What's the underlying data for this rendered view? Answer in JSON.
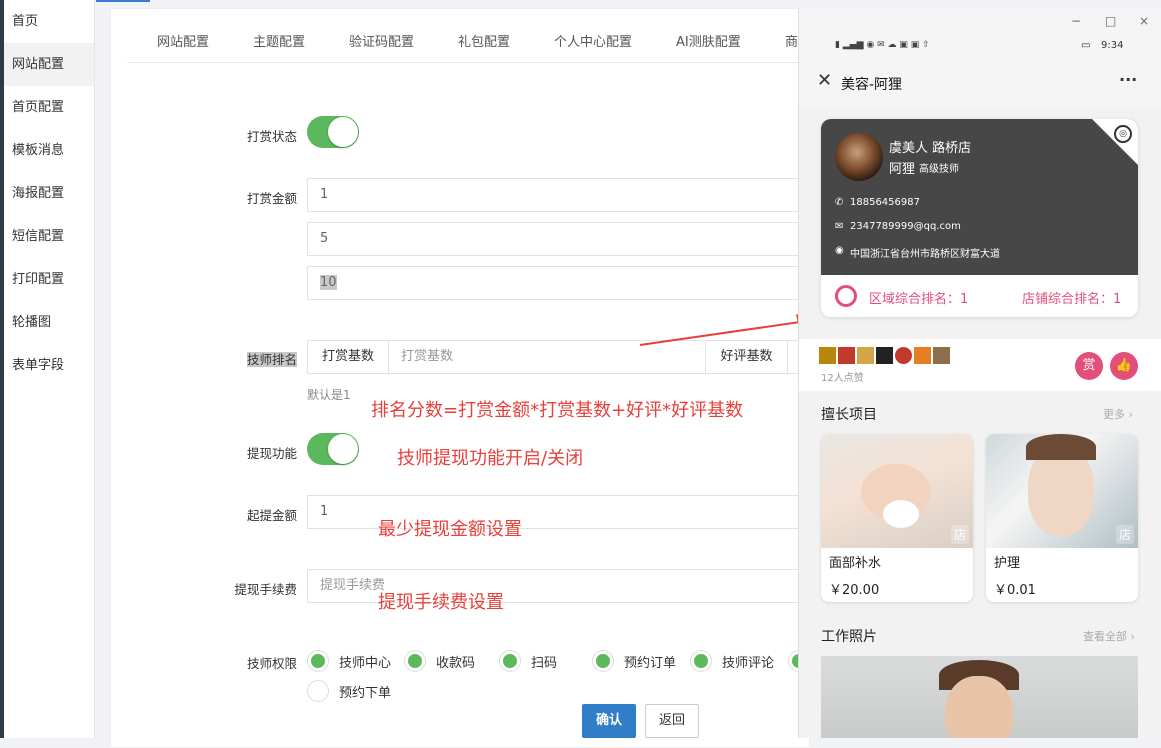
{
  "sidebar": {
    "items": [
      {
        "label": "首页"
      },
      {
        "label": "网站配置"
      },
      {
        "label": "首页配置"
      },
      {
        "label": "模板消息"
      },
      {
        "label": "海报配置"
      },
      {
        "label": "短信配置"
      },
      {
        "label": "打印配置"
      },
      {
        "label": "轮播图"
      },
      {
        "label": "表单字段"
      }
    ],
    "active_index": 1
  },
  "tabs": [
    "网站配置",
    "主题配置",
    "验证码配置",
    "礼包配置",
    "个人中心配置",
    "AI测肤配置",
    "商"
  ],
  "form": {
    "reward_status_label": "打赏状态",
    "reward_amount_label": "打赏金额",
    "reward_amounts": [
      "1",
      "5",
      "10"
    ],
    "ranking_label": "技师排名",
    "reward_base_addon": "打赏基数",
    "reward_base_placeholder": "打赏基数",
    "review_base_addon": "好评基数",
    "default_hint": "默认是1",
    "withdraw_label": "提现功能",
    "min_withdraw_label": "起提金额",
    "min_withdraw_value": "1",
    "fee_label": "提现手续费",
    "fee_placeholder": "提现手续费",
    "perm_label": "技师权限",
    "permissions": [
      {
        "label": "技师中心",
        "checked": true
      },
      {
        "label": "收款码",
        "checked": true
      },
      {
        "label": "扫码",
        "checked": true
      },
      {
        "label": "预约订单",
        "checked": true
      },
      {
        "label": "技师评论",
        "checked": true
      },
      {
        "label": "预约下单",
        "checked": false
      }
    ],
    "confirm_label": "确认",
    "back_label": "返回"
  },
  "annotations": {
    "formula": "排名分数=打赏金额*打赏基数+好评*好评基数",
    "withdraw": "技师提现功能开启/关闭",
    "min": "最少提现金额设置",
    "fee": "提现手续费设置"
  },
  "phone": {
    "window_controls": [
      "−",
      "□",
      "×"
    ],
    "time": "9:34",
    "title": "美容-阿狸",
    "more": "···",
    "store_name": "虞美人 路桥店",
    "tech_name": "阿狸",
    "tech_level": "高级技师",
    "phone": "18856456987",
    "email": "2347789999@qq.com",
    "address": "中国浙江省台州市路桥区财富大道",
    "region_rank": "区域综合排名：1",
    "store_rank": "店铺综合排名：1",
    "likes_count": "12人点赞",
    "reward_btn": "赏",
    "skills_title": "擅长项目",
    "skills_more": "更多",
    "services": [
      {
        "name": "面部补水",
        "price": "￥20.00",
        "tag": "店"
      },
      {
        "name": "护理",
        "price": "￥0.01",
        "tag": "店"
      }
    ],
    "photos_title": "工作照片",
    "photos_more": "查看全部"
  },
  "colors": {
    "toggle_on": "#5cb85c",
    "annotation": "#e8403a",
    "primary_button": "#2f7ec7",
    "rank_text": "#e2507a",
    "card_dark": "#474747"
  }
}
